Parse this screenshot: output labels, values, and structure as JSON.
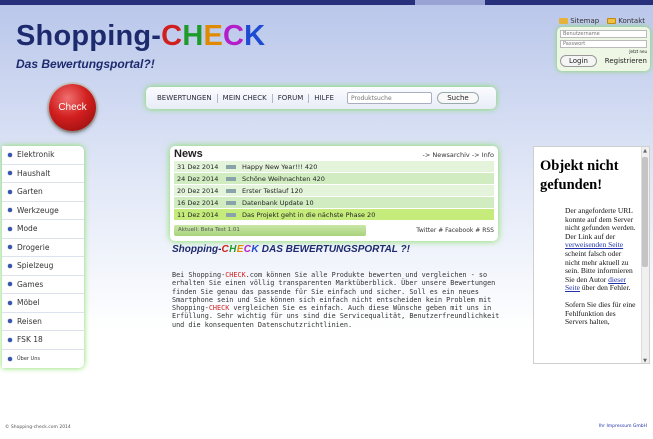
{
  "brand": {
    "logo_prefix": "Shopping-",
    "logo_letters": [
      "C",
      "H",
      "E",
      "C",
      "K"
    ],
    "tagline": "Das Bewertungsportal?!",
    "check_button": "Check"
  },
  "toplinks": {
    "sitemap": "Sitemap",
    "kontakt": "Kontakt"
  },
  "login": {
    "username_placeholder": "Benutzername",
    "password_placeholder": "Passwort",
    "small_text": "Jetzt neu",
    "login_button": "Login",
    "register_link": "Registrieren"
  },
  "nav": {
    "items": [
      "BEWERTUNGEN",
      "MEIN CHECK",
      "FORUM",
      "HILFE"
    ],
    "search_placeholder": "Produktsuche",
    "search_button": "Suche"
  },
  "sidebar": {
    "items": [
      "Elektronik",
      "Haushalt",
      "Garten",
      "Werkzeuge",
      "Mode",
      "Drogerie",
      "Spielzeug",
      "Games",
      "Möbel",
      "Reisen",
      "FSK 18",
      "Über Uns"
    ]
  },
  "news": {
    "title": "News",
    "links": "-> Newsarchiv  -> Info",
    "rows": [
      {
        "date": "31 Dez 2014",
        "text": "Happy New Year!!! 420"
      },
      {
        "date": "24 Dez 2014",
        "text": "Schöne Weihnachten 420"
      },
      {
        "date": "20 Dez 2014",
        "text": "Erster Testlauf 120"
      },
      {
        "date": "16 Dez 2014",
        "text": "Datenbank Update 10"
      },
      {
        "date": "11 Dez 2014",
        "text": "Das Projekt geht in die nächste Phase 20"
      }
    ],
    "status": "Aktuell: Beta Test 1.01",
    "social": "Twitter # Facebook # RSS"
  },
  "main": {
    "heading_prefix": "Shopping-",
    "heading_letters": [
      "C",
      "H",
      "E",
      "C",
      "K"
    ],
    "heading_suffix": " DAS BEWERTUNGSPORTAL ?!",
    "body_parts": [
      "Bei Shopping-",
      "CHECK",
      ".com können Sie alle Produkte bewerten und vergleichen - so erhalten Sie einen völlig transparenten Marktüberblick. Über unsere Bewertungen finden Sie genau das passende für Sie einfach und sicher. Soll es ein neues Smartphone sein und Sie können sich einfach nicht entscheiden kein Problem mit Shopping-",
      "CHECK",
      " vergleichen Sie es einfach. Auch diese Wünsche geben mit uns in Erfüllung. Sehr wichtig für uns sind die Servicequalität, Benutzerfreundlichkeit und die konsequenten Datenschutzrichtlinien."
    ]
  },
  "error": {
    "title": "Objekt nicht gefunden!",
    "p1_before": "Der angeforderte URL konnte auf dem Server nicht gefunden werden. Der Link auf der ",
    "p1_link": "verweisenden Seite",
    "p1_mid": " scheint falsch oder nicht mehr aktuell zu sein. Bitte informieren Sie den Autor ",
    "p1_link2": "dieser Seite",
    "p1_after": " über den Fehler.",
    "p2": "Sofern Sie dies für eine Fehlfunktion des Servers halten,"
  },
  "footer": {
    "left": "© Shopping-check.com 2014",
    "right": "Ihr Impressum GmbH"
  },
  "colors": {
    "brand_navy": "#1d2b6e",
    "glow_green": "#7fdc5a",
    "check_red": "#d21f1f",
    "letter_colors": [
      "#d11e1e",
      "#1f9b2b",
      "#e08a00",
      "#b21ec8",
      "#1e4bd1"
    ]
  }
}
